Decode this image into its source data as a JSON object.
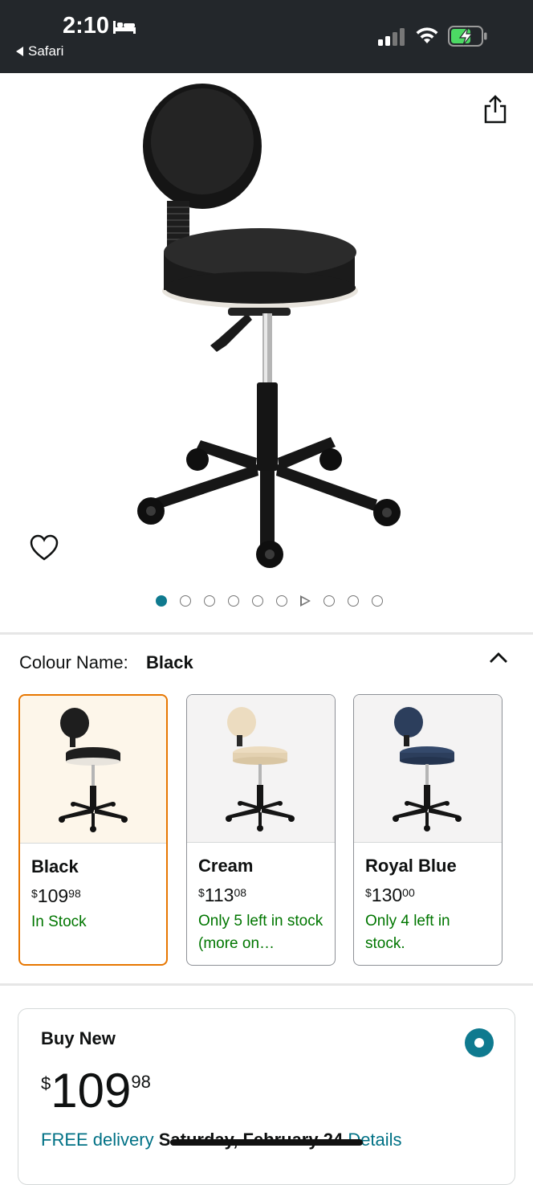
{
  "status_bar": {
    "time": "2:10",
    "back_app": "Safari",
    "icons": [
      "bed-icon",
      "signal-icon",
      "wifi-icon",
      "battery-charging-icon"
    ]
  },
  "product_image": {
    "icons": [
      "share-icon",
      "heart-icon"
    ],
    "carousel": {
      "total_dots": 10,
      "active_index": 0,
      "video_index": 5
    }
  },
  "colour": {
    "label": "Colour Name:",
    "selected": "Black",
    "options": [
      {
        "name": "Black",
        "price_symbol": "$",
        "price_whole": "109",
        "price_fraction": "98",
        "stock": "In Stock",
        "seat_color": "#1e1e1e"
      },
      {
        "name": "Cream",
        "price_symbol": "$",
        "price_whole": "113",
        "price_fraction": "08",
        "stock": "Only 5 left in stock (more on…",
        "seat_color": "#ecdcc0"
      },
      {
        "name": "Royal Blue",
        "price_symbol": "$",
        "price_whole": "130",
        "price_fraction": "00",
        "stock": "Only 4 left in stock.",
        "seat_color": "#2c3e5c"
      }
    ]
  },
  "buy_box": {
    "title": "Buy New",
    "price_symbol": "$",
    "price_whole": "109",
    "price_fraction": "98",
    "delivery_prefix": "FREE delivery",
    "delivery_date": "Saturday, February 24",
    "details_link": "Details"
  },
  "colors": {
    "accent_teal": "#0f7a8f",
    "stock_green": "#007600",
    "link_blue": "#007185",
    "selected_orange": "#e77600"
  }
}
